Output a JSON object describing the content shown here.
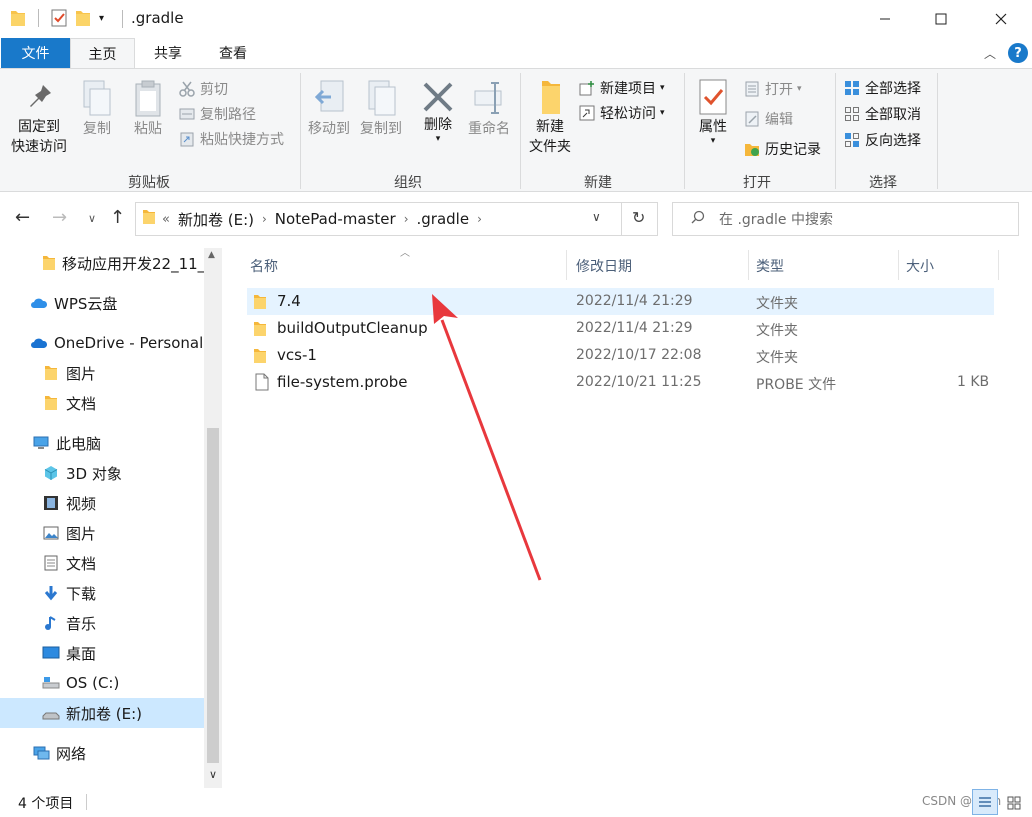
{
  "window": {
    "title": ".gradle",
    "controls": [
      "minimize-icon",
      "maximize-icon",
      "close-icon"
    ]
  },
  "ribbon_tabs": [
    {
      "label": "文件"
    },
    {
      "label": "主页"
    },
    {
      "label": "共享"
    },
    {
      "label": "查看"
    }
  ],
  "ribbon": {
    "clipboard": {
      "group": "剪贴板",
      "pin_line1": "固定到",
      "pin_line2": "快速访问",
      "copy": "复制",
      "paste": "粘贴",
      "cut": "剪切",
      "copy_path": "复制路径",
      "paste_shortcut": "粘贴快捷方式"
    },
    "organize": {
      "group": "组织",
      "move_to": "移动到",
      "copy_to": "复制到",
      "delete": "删除",
      "rename": "重命名"
    },
    "new": {
      "group": "新建",
      "new_folder_line1": "新建",
      "new_folder_line2": "文件夹",
      "new_item": "新建项目",
      "easy_access": "轻松访问"
    },
    "open": {
      "group": "打开",
      "properties": "属性",
      "open": "打开",
      "edit": "编辑",
      "history": "历史记录"
    },
    "select": {
      "group": "选择",
      "select_all": "全部选择",
      "select_none": "全部取消",
      "invert": "反向选择"
    }
  },
  "address": {
    "prefix": "«",
    "crumbs": [
      "新加卷 (E:)",
      "NotePad-master",
      ".gradle"
    ],
    "search_placeholder": "在 .gradle 中搜索"
  },
  "nav_pane": [
    {
      "label": "移动应用开发22_11_",
      "icon": "folder-icon"
    },
    {
      "label": "WPS云盘",
      "icon": "cloud-icon"
    },
    {
      "label": "OneDrive - Personal",
      "icon": "onedrive-icon"
    },
    {
      "label": "图片",
      "icon": "folder-icon"
    },
    {
      "label": "文档",
      "icon": "folder-icon"
    },
    {
      "label": "此电脑",
      "icon": "computer-icon"
    },
    {
      "label": "3D 对象",
      "icon": "3d-objects-icon"
    },
    {
      "label": "视频",
      "icon": "video-icon"
    },
    {
      "label": "图片",
      "icon": "pictures-icon"
    },
    {
      "label": "文档",
      "icon": "documents-icon"
    },
    {
      "label": "下载",
      "icon": "download-icon"
    },
    {
      "label": "音乐",
      "icon": "music-icon"
    },
    {
      "label": "桌面",
      "icon": "desktop-icon"
    },
    {
      "label": "OS (C:)",
      "icon": "drive-c-icon"
    },
    {
      "label": "新加卷 (E:)",
      "icon": "drive-icon",
      "selected": true
    },
    {
      "label": "网络",
      "icon": "network-icon"
    }
  ],
  "columns": [
    "名称",
    "修改日期",
    "类型",
    "大小"
  ],
  "files": [
    {
      "name": "7.4",
      "date": "2022/11/4 21:29",
      "type": "文件夹",
      "size": "",
      "icon": "folder-icon",
      "hover": true
    },
    {
      "name": "buildOutputCleanup",
      "date": "2022/11/4 21:29",
      "type": "文件夹",
      "size": "",
      "icon": "folder-icon"
    },
    {
      "name": "vcs-1",
      "date": "2022/10/17 22:08",
      "type": "文件夹",
      "size": "",
      "icon": "folder-icon"
    },
    {
      "name": "file-system.probe",
      "date": "2022/10/21 11:25",
      "type": "PROBE 文件",
      "size": "1 KB",
      "icon": "file-icon"
    }
  ],
  "status": {
    "count": "4 个项目",
    "watermark": "CSDN @Pelm"
  },
  "colors": {
    "accent": "#1979ca",
    "selection": "#cce8ff",
    "hover": "#e5f3ff",
    "annotation_arrow": "#e8383d"
  }
}
